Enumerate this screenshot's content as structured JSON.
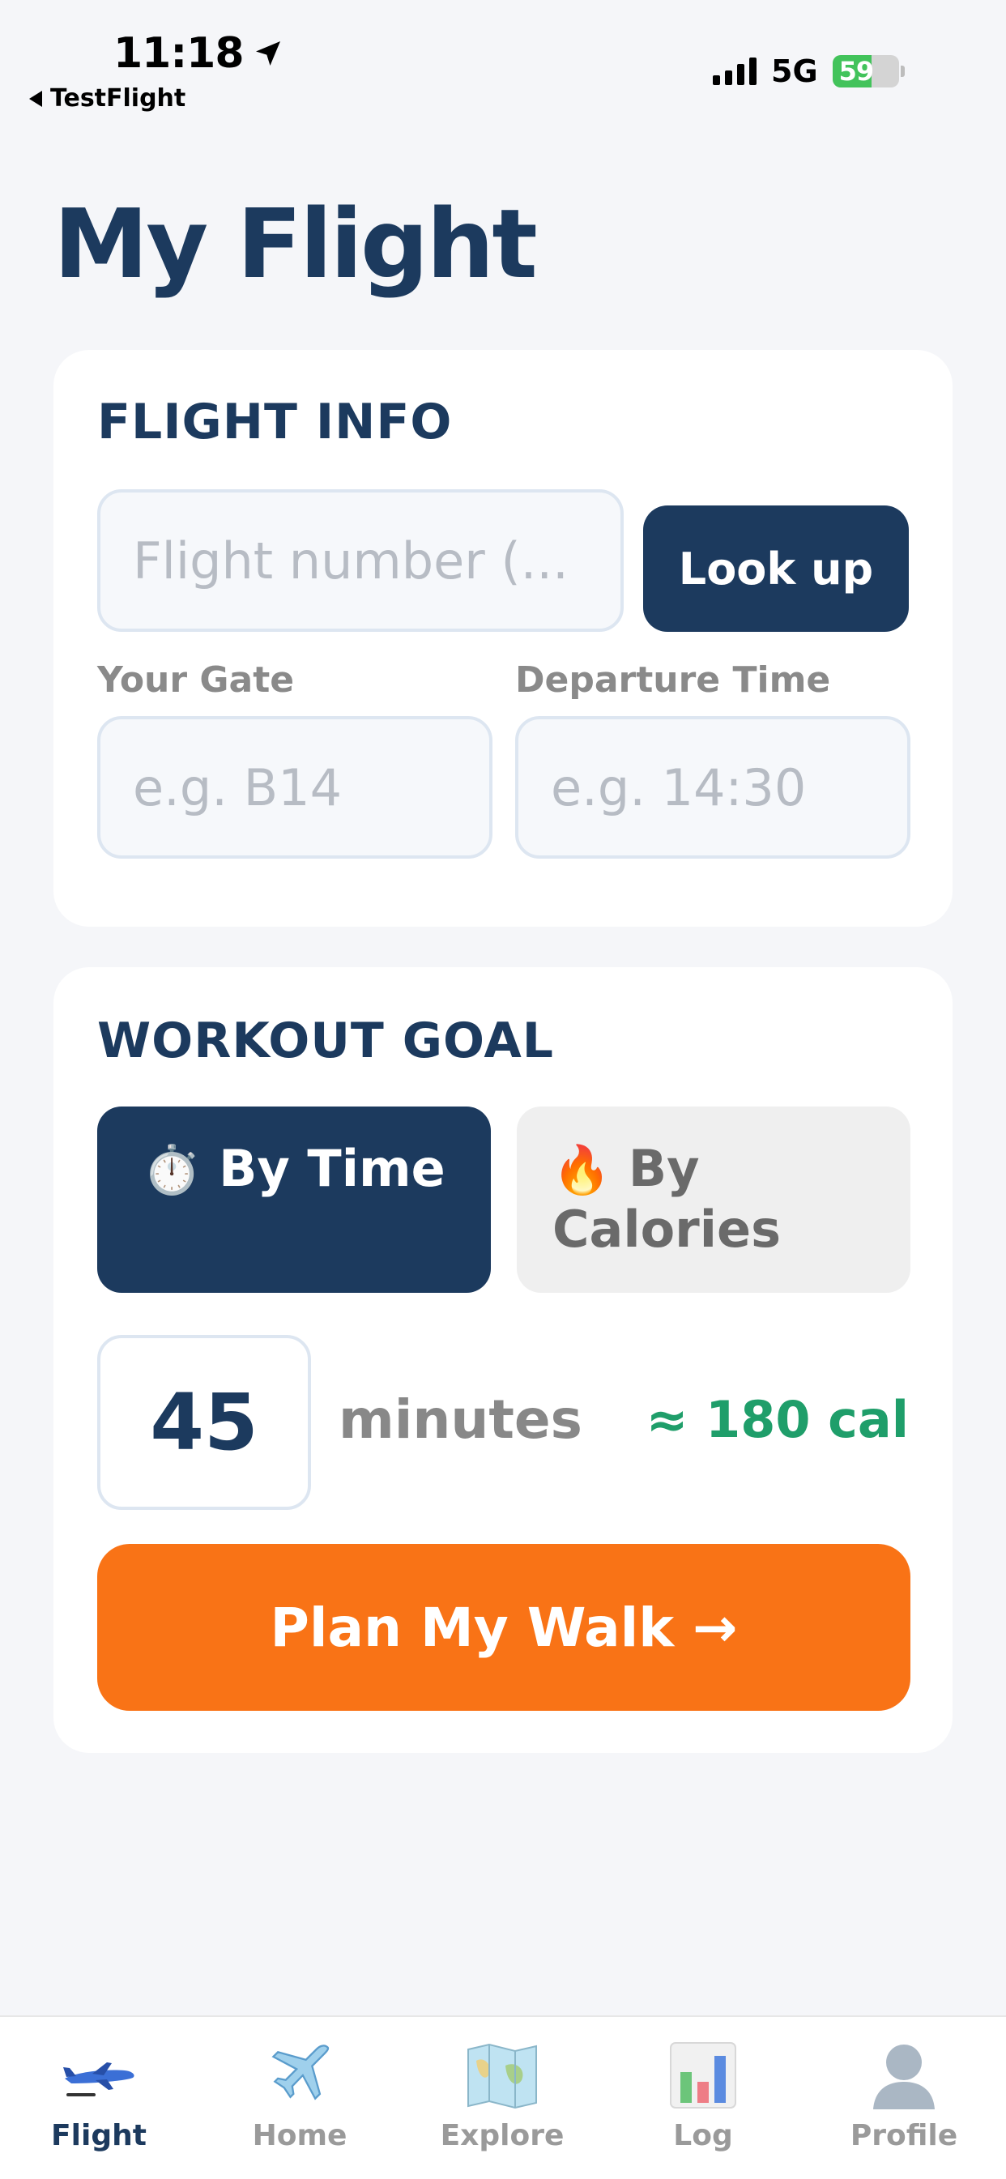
{
  "status_bar": {
    "time": "11:18",
    "back_label": "TestFlight",
    "network": "5G",
    "battery": "59",
    "battery_level": 0.59
  },
  "page": {
    "title": "My Flight"
  },
  "flight_info": {
    "title": "FLIGHT INFO",
    "flight_number_placeholder": "Flight number (...",
    "lookup_label": "Look up",
    "gate_label": "Your Gate",
    "gate_placeholder": "e.g. B14",
    "departure_label": "Departure Time",
    "departure_placeholder": "e.g. 14:30"
  },
  "workout_goal": {
    "title": "WORKOUT GOAL",
    "by_time_emoji": "⏱️",
    "by_time_label": "By Time",
    "by_calories_emoji": "🔥",
    "by_calories_label": "By Calories",
    "selected": "By Time",
    "value": "45",
    "unit": "minutes",
    "estimate": "≈ 180 cal",
    "plan_label": "Plan My Walk →"
  },
  "tabs": [
    {
      "label": "Flight",
      "icon": "airplane-side-icon",
      "active": true
    },
    {
      "label": "Home",
      "icon": "airplane-icon",
      "active": false
    },
    {
      "label": "Explore",
      "icon": "map-icon",
      "active": false
    },
    {
      "label": "Log",
      "icon": "bar-chart-icon",
      "active": false
    },
    {
      "label": "Profile",
      "icon": "person-silhouette-icon",
      "active": false
    }
  ],
  "colors": {
    "primary": "#1c3a5e",
    "accent": "#f97316",
    "success": "#1f9e6a",
    "background": "#f5f6f9"
  }
}
